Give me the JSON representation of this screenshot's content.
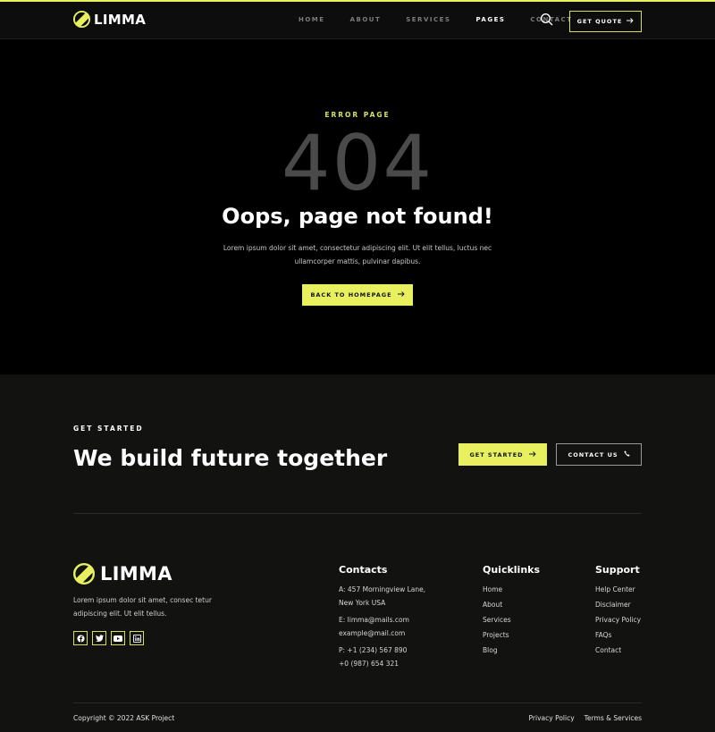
{
  "colors": {
    "accent": "#e8f05f",
    "background": "#000000",
    "footer_bg": "#121310",
    "muted_404": "#4a4a4a"
  },
  "brand": {
    "name": "LIMMA",
    "logo_icon": "limma-logo-icon"
  },
  "nav": {
    "links": [
      {
        "label": "HOME",
        "active": false
      },
      {
        "label": "ABOUT",
        "active": false
      },
      {
        "label": "SERVICES",
        "active": false
      },
      {
        "label": "PAGES",
        "active": true
      },
      {
        "label": "CONTACT",
        "active": false
      }
    ],
    "search_icon": "search-icon",
    "quote_button": "GET QUOTE"
  },
  "hero": {
    "label": "ERROR PAGE",
    "code": "404",
    "title": "Oops, page not found!",
    "description_line1": "Lorem ipsum dolor sit amet, consectetur adipiscing elit. Ut elit tellus, luctus nec",
    "description_line2": "ullamcorper mattis, pulvinar dapibus.",
    "button": "BACK TO HOMEPAGE"
  },
  "cta": {
    "label": "GET STARTED",
    "title": "We build future together",
    "primary_button": "GET STARTED",
    "secondary_button": "CONTACT US"
  },
  "footer": {
    "about_line1": "Lorem ipsum dolor sit amet, consec tetur",
    "about_line2": "adipiscing elit. Ut elit tellus.",
    "socials": [
      "facebook-icon",
      "twitter-icon",
      "youtube-icon",
      "linkedin-icon"
    ],
    "contacts": {
      "title": "Contacts",
      "address_line1": "A: 457 Morningview Lane,",
      "address_line2": "New York USA",
      "email_line1": "E: limma@mails.com",
      "email_line2": "example@mail.com",
      "phone_line1": "P: +1 (234) 567 890",
      "phone_line2": "+0 (987) 654 321"
    },
    "quicklinks": {
      "title": "Quicklinks",
      "items": [
        "Home",
        "About",
        "Services",
        "Projects",
        "Blog"
      ]
    },
    "support": {
      "title": "Support",
      "items": [
        "Help Center",
        "Disclaimer",
        "Privacy Policy",
        "FAQs",
        "Contact"
      ]
    },
    "copyright": "Copyright © 2022 ASK Project",
    "legal_links": [
      "Privacy Policy",
      "Terms & Services"
    ]
  }
}
